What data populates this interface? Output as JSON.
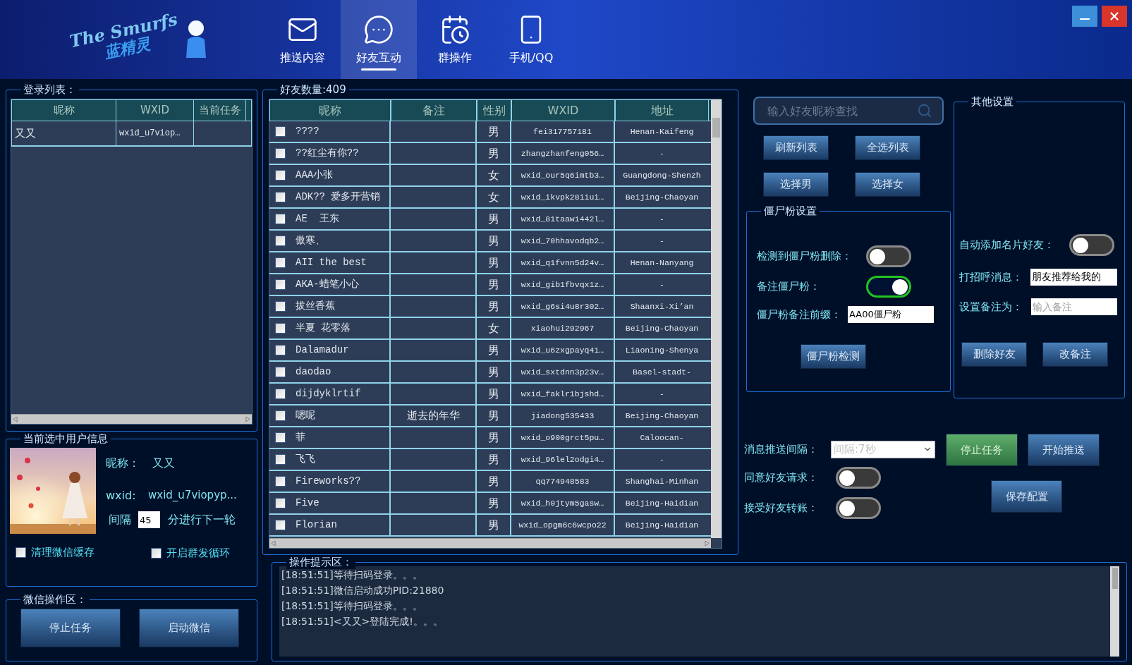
{
  "header": {
    "logo_title": "The Smurfs",
    "logo_subtitle": "蓝精灵",
    "tabs": [
      {
        "label": "推送内容",
        "selected": false
      },
      {
        "label": "好友互动",
        "selected": true
      },
      {
        "label": "群操作",
        "selected": false
      },
      {
        "label": "手机/QQ",
        "selected": false
      }
    ]
  },
  "login_list": {
    "title": "登录列表：",
    "columns": [
      "昵称",
      "WXID",
      "当前任务"
    ],
    "rows": [
      {
        "nickname": "又又",
        "wxid": "wxid_u7viop…"
      }
    ]
  },
  "user_info": {
    "title": "当前选中用户信息",
    "nickname_label": "昵称：",
    "nickname": "又又",
    "wxid_label": "wxid:",
    "wxid": "wxid_u7viopyp...",
    "interval_label": "间隔",
    "interval": "45",
    "interval_suffix": "分进行下一轮",
    "checkboxes": [
      {
        "label": "清理微信缓存",
        "checked": false
      },
      {
        "label": "开启群发循环",
        "checked": false
      }
    ]
  },
  "wechat_ops": {
    "title": "微信操作区：",
    "buttons": [
      "停止任务",
      "启动微信"
    ]
  },
  "friends": {
    "title": "好友数量:409",
    "columns": [
      "昵称",
      "备注",
      "性别",
      "WXID",
      "地址"
    ],
    "rows": [
      {
        "checked": false,
        "nickname": "????",
        "gender": "男",
        "wxid": "fei317757181",
        "address": "Henan-Kaifeng"
      },
      {
        "checked": false,
        "nickname": "??红尘有你??",
        "gender": "男",
        "wxid": "zhangzhanfeng056…",
        "address": "-"
      },
      {
        "checked": false,
        "nickname": "AAA小张",
        "gender": "女",
        "wxid": "wxid_our5q6imtb3…",
        "address": "Guangdong-Shenzh"
      },
      {
        "checked": false,
        "nickname": "ADK?? 爱多开营销",
        "gender": "女",
        "wxid": "wxid_ikvpk28iiui…",
        "address": "Beijing-Chaoyan"
      },
      {
        "checked": false,
        "nickname": "AE  王东",
        "gender": "男",
        "wxid": "wxid_81taawi442l…",
        "address": "-"
      },
      {
        "checked": false,
        "nickname": "傲寒、",
        "gender": "男",
        "wxid": "wxid_70hhavodqb2…",
        "address": "-"
      },
      {
        "checked": false,
        "nickname": "AII the best",
        "gender": "男",
        "wxid": "wxid_q1fvnn5d24v…",
        "address": "Henan-Nanyang"
      },
      {
        "checked": false,
        "nickname": "AKA-蜡笔小心",
        "gender": "男",
        "wxid": "wxid_gib1fbvqx1z…",
        "address": "-"
      },
      {
        "checked": false,
        "nickname": "拔丝香蕉",
        "gender": "男",
        "wxid": "wxid_g6si4u8r302…",
        "address": "Shaanxi-Xi’an"
      },
      {
        "checked": false,
        "nickname": "半夏 花零落",
        "gender": "女",
        "wxid": "xiaohui292967",
        "address": "Beijing-Chaoyan"
      },
      {
        "checked": false,
        "nickname": "Dalamadur",
        "gender": "男",
        "wxid": "wxid_u6zxgpayq41…",
        "address": "Liaoning-Shenya"
      },
      {
        "checked": false,
        "nickname": "daodao",
        "gender": "男",
        "wxid": "wxid_sxtdnn3p23v…",
        "address": "Basel-stadt-"
      },
      {
        "checked": false,
        "nickname": "dijdyklrtif",
        "gender": "男",
        "wxid": "wxid_faklr1bjshd…",
        "address": "-"
      },
      {
        "checked": false,
        "nickname": "嗯呢",
        "remark": "逝去的年华",
        "gender": "男",
        "wxid": "jiadong535433",
        "address": "Beijing-Chaoyan"
      },
      {
        "checked": false,
        "nickname": "菲",
        "gender": "男",
        "wxid": "wxid_o900grct5pu…",
        "address": "Caloocan-"
      },
      {
        "checked": false,
        "nickname": "飞飞",
        "gender": "男",
        "wxid": "wxid_96lel2odgi4…",
        "address": "-"
      },
      {
        "checked": false,
        "nickname": "Fireworks??",
        "gender": "男",
        "wxid": "qq774948583",
        "address": "Shanghai-Minhan"
      },
      {
        "checked": false,
        "nickname": "Five",
        "gender": "男",
        "wxid": "wxid_h0jtym5gasw…",
        "address": "Beijing-Haidian"
      },
      {
        "checked": false,
        "nickname": "Florian",
        "gender": "男",
        "wxid": "wxid_opgm6c6wcpo22",
        "address": "Beijing-Haidian"
      }
    ]
  },
  "search": {
    "placeholder": "输入好友昵称查找"
  },
  "list_buttons": [
    "刷新列表",
    "全选列表",
    "选择男",
    "选择女"
  ],
  "zombie": {
    "title": "僵尸粉设置",
    "switches": [
      {
        "label": "检测到僵尸粉删除：",
        "on": false
      },
      {
        "label": "备注僵尸粉：",
        "on": true
      }
    ],
    "prefix_label": "僵尸粉备注前缀：",
    "prefix": "AA00僵尸粉",
    "button": "僵尸粉检测"
  },
  "other": {
    "title": "其他设置",
    "auto_add_label": "自动添加名片好友：",
    "auto_add_on": false,
    "greeting_label": "打招呼消息：",
    "greeting": "朋友推荐给我的",
    "remark_label": "设置备注为：",
    "remark_placeholder": "输入备注",
    "buttons": [
      "删除好友",
      "改备注"
    ]
  },
  "push": {
    "interval_label": "消息推送间隔：",
    "interval": "间隔:7秒",
    "interval_disabled": true,
    "buttons": [
      {
        "label": "停止任务",
        "highlighted": true
      },
      {
        "label": "开始推送",
        "highlighted": false
      }
    ],
    "switches": [
      {
        "label": "同意好友请求：",
        "on": false
      },
      {
        "label": "接受好友转账：",
        "on": false
      }
    ],
    "save_button": "保存配置"
  },
  "log": {
    "title": "操作提示区：",
    "lines": [
      "[18:51:51]等待扫码登录。。。",
      "[18:51:51]微信启动成功PID:21880",
      "[18:51:51]等待扫码登录。。。",
      "[18:51:51]<又又>登陆完成!。。。"
    ]
  }
}
